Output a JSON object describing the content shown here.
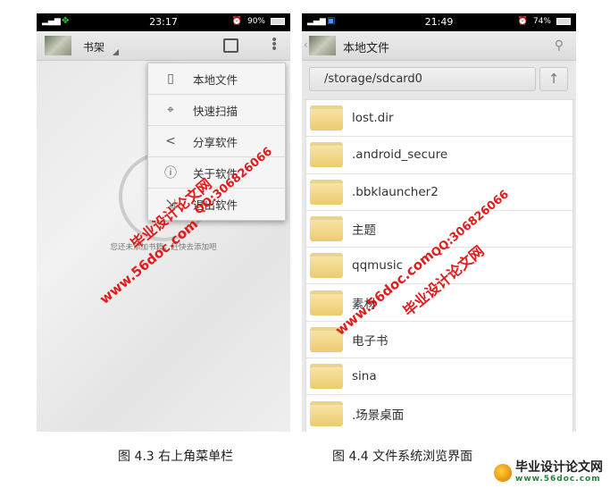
{
  "left_screen": {
    "status": {
      "time": "23:17",
      "battery": "90%"
    },
    "title": "书架",
    "menu": [
      {
        "icon": "tablet-icon",
        "label": "本地文件"
      },
      {
        "icon": "crosshair-icon",
        "label": "快速扫描"
      },
      {
        "icon": "share-icon",
        "label": "分享软件"
      },
      {
        "icon": "info-icon",
        "label": "关于软件"
      },
      {
        "icon": "exit-icon",
        "label": "退出软件"
      }
    ],
    "empty_text": "您还未添加书籍，赶快去添加吧"
  },
  "right_screen": {
    "status": {
      "time": "21:49",
      "battery": "74%"
    },
    "title": "本地文件",
    "path": "/storage/sdcard0",
    "up_icon": "↑",
    "folders": [
      "lost.dir",
      ".android_secure",
      ".bbklauncher2",
      "主题",
      "qqmusic",
      "素材",
      "电子书",
      "sina",
      ".场景桌面"
    ]
  },
  "captions": {
    "left": "图 4.3 右上角菜单栏",
    "right": "图 4.4 文件系统浏览界面"
  },
  "watermark": {
    "site": "www.56doc.com",
    "name": "毕业设计论文网",
    "qq": "QQ:306826066",
    "color": "#e01010"
  }
}
